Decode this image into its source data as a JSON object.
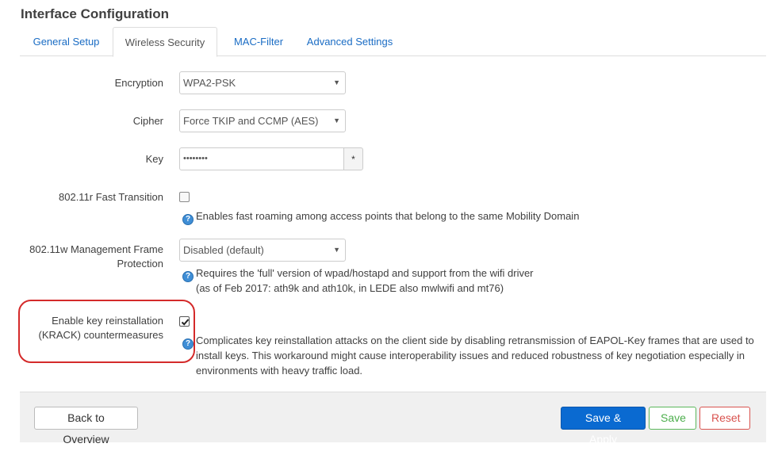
{
  "page": {
    "title": "Interface Configuration"
  },
  "tabs": [
    {
      "label": "General Setup"
    },
    {
      "label": "Wireless Security"
    },
    {
      "label": "MAC-Filter"
    },
    {
      "label": "Advanced Settings"
    }
  ],
  "form": {
    "encryption": {
      "label": "Encryption",
      "value": "WPA2-PSK"
    },
    "cipher": {
      "label": "Cipher",
      "value": "Force TKIP and CCMP (AES)"
    },
    "key": {
      "label": "Key",
      "value": "••••••••",
      "toggle_label": "*"
    },
    "fast_transition": {
      "label": "802.11r Fast Transition",
      "checked": false,
      "help": "Enables fast roaming among access points that belong to the same Mobility Domain"
    },
    "mgmt_frame": {
      "label_line1": "802.11w Management Frame",
      "label_line2": "Protection",
      "value": "Disabled (default)",
      "help_line1": "Requires the 'full' version of wpad/hostapd and support from the wifi driver",
      "help_line2": "(as of Feb 2017: ath9k and ath10k, in LEDE also mwlwifi and mt76)"
    },
    "krack": {
      "label_line1": "Enable key reinstallation",
      "label_line2": "(KRACK) countermeasures",
      "checked": true,
      "help_line1": "Complicates key reinstallation attacks on the client side by disabling retransmission of EAPOL-Key frames that are used to",
      "help_line2": "install keys. This workaround might cause interoperability issues and reduced robustness of key negotiation especially in",
      "help_line3": "environments with heavy traffic load."
    }
  },
  "footer": {
    "back_label": "Back to Overview",
    "save_apply_label": "Save & Apply",
    "save_label": "Save",
    "reset_label": "Reset"
  },
  "colors": {
    "link": "#1a6cc4",
    "primary": "#0a6ad1",
    "success": "#5cb85c",
    "danger": "#d9534f",
    "highlight": "#d42a2a"
  }
}
